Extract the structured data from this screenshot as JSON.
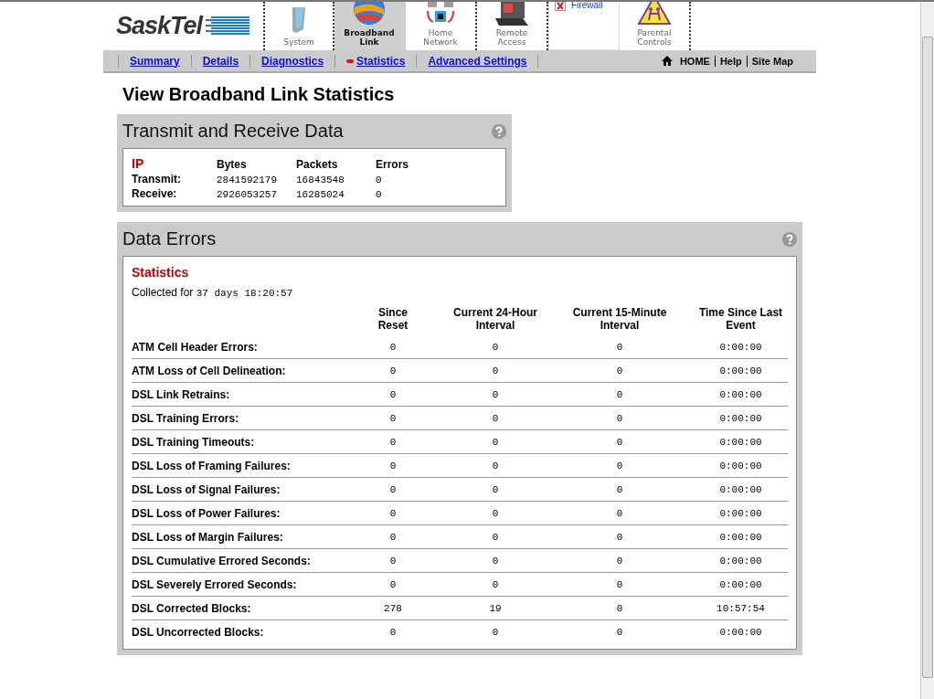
{
  "tabs": [
    {
      "label": "System",
      "kind": "system",
      "selected": false
    },
    {
      "label": "Broadband Link",
      "kind": "globe",
      "selected": true
    },
    {
      "label": "Home Network",
      "kind": "network",
      "selected": false
    },
    {
      "label": "Remote Access",
      "kind": "laptop",
      "selected": false
    },
    {
      "label": "Firewall",
      "kind": "broken",
      "selected": false
    },
    {
      "label": "Parental Controls",
      "kind": "warning",
      "selected": false
    }
  ],
  "subnav": [
    {
      "label": "Summary",
      "selected": false
    },
    {
      "label": "Details",
      "selected": false
    },
    {
      "label": "Diagnostics",
      "selected": false
    },
    {
      "label": "Statistics",
      "selected": true
    },
    {
      "label": "Advanced Settings",
      "selected": false
    }
  ],
  "utility_links": [
    {
      "label": "HOME",
      "kind": "home"
    },
    {
      "label": "Help",
      "kind": "plain"
    },
    {
      "label": "Site Map",
      "kind": "plain"
    }
  ],
  "page_title": "View Broadband Link Statistics",
  "transmit_panel": {
    "title": "Transmit and Receive Data",
    "section": "IP",
    "columns": [
      "Bytes",
      "Packets",
      "Errors"
    ],
    "rows": [
      {
        "label": "Transmit:",
        "values": [
          "2841592179",
          "16843548",
          "0"
        ]
      },
      {
        "label": "Receive:",
        "values": [
          "2926053257",
          "16285024",
          "0"
        ]
      }
    ]
  },
  "errors_panel": {
    "title": "Data Errors",
    "section": "Statistics",
    "collected_label": "Collected for",
    "collected_value": "37 days 18:20:57",
    "column_lines": [
      [
        "Since",
        "Reset"
      ],
      [
        "Current 24-Hour",
        "Interval"
      ],
      [
        "Current 15-Minute",
        "Interval"
      ],
      [
        "Time Since Last",
        "Event"
      ]
    ],
    "rows": [
      {
        "label": "ATM Cell Header Errors:",
        "values": [
          "0",
          "0",
          "0",
          "0:00:00"
        ]
      },
      {
        "label": "ATM Loss of Cell Delineation:",
        "values": [
          "0",
          "0",
          "0",
          "0:00:00"
        ]
      },
      {
        "label": "DSL Link Retrains:",
        "values": [
          "0",
          "0",
          "0",
          "0:00:00"
        ]
      },
      {
        "label": "DSL Training Errors:",
        "values": [
          "0",
          "0",
          "0",
          "0:00:00"
        ]
      },
      {
        "label": "DSL Training Timeouts:",
        "values": [
          "0",
          "0",
          "0",
          "0:00:00"
        ]
      },
      {
        "label": "DSL Loss of Framing Failures:",
        "values": [
          "0",
          "0",
          "0",
          "0:00:00"
        ]
      },
      {
        "label": "DSL Loss of Signal Failures:",
        "values": [
          "0",
          "0",
          "0",
          "0:00:00"
        ]
      },
      {
        "label": "DSL Loss of Power Failures:",
        "values": [
          "0",
          "0",
          "0",
          "0:00:00"
        ]
      },
      {
        "label": "DSL Loss of Margin Failures:",
        "values": [
          "0",
          "0",
          "0",
          "0:00:00"
        ]
      },
      {
        "label": "DSL Cumulative Errored Seconds:",
        "values": [
          "0",
          "0",
          "0",
          "0:00:00"
        ]
      },
      {
        "label": "DSL Severely Errored Seconds:",
        "values": [
          "0",
          "0",
          "0",
          "0:00:00"
        ]
      },
      {
        "label": "DSL Corrected Blocks:",
        "values": [
          "278",
          "19",
          "0",
          "10:57:54"
        ]
      },
      {
        "label": "DSL Uncorrected Blocks:",
        "values": [
          "0",
          "0",
          "0",
          "0:00:00"
        ]
      }
    ]
  },
  "logo": "SaskTel"
}
